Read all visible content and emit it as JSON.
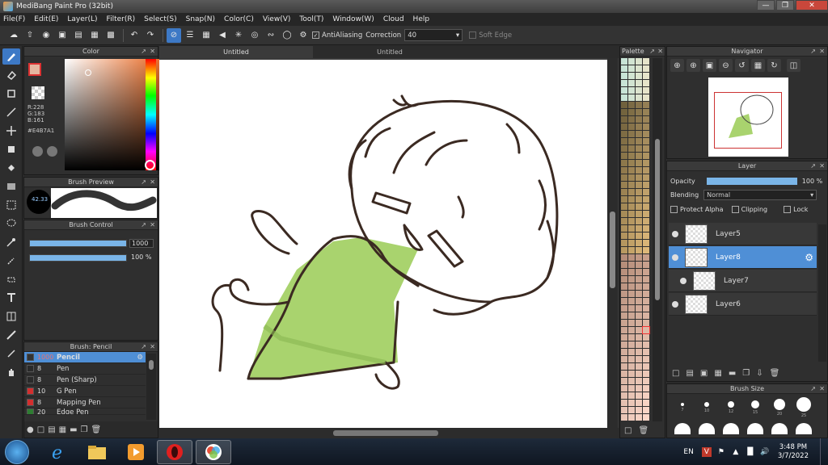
{
  "window": {
    "title": "MediBang Paint Pro (32bit)"
  },
  "menu": [
    "File(F)",
    "Edit(E)",
    "Layer(L)",
    "Filter(R)",
    "Select(S)",
    "Snap(N)",
    "Color(C)",
    "View(V)",
    "Tool(T)",
    "Window(W)",
    "Cloud",
    "Help"
  ],
  "toolbar": {
    "antialiasing_label": "AntiAliasing",
    "correction_label": "Correction",
    "correction_value": "40",
    "soft_edge_label": "Soft Edge"
  },
  "color_panel": {
    "title": "Color",
    "r": "R:228",
    "g": "G:183",
    "b": "B:161",
    "hex": "#E4B7A1",
    "foreground": "#E4B7A1"
  },
  "brush_preview": {
    "title": "Brush Preview",
    "size_label": "42.33"
  },
  "brush_control": {
    "title": "Brush Control",
    "size_value": "1000",
    "opacity_value": "100 %"
  },
  "brush_list": {
    "title": "Brush: Pencil",
    "items": [
      {
        "size": "1000",
        "name": "Pencil",
        "color": "#2a2a2a"
      },
      {
        "size": "8",
        "name": "Pen",
        "color": "#2a2a2a"
      },
      {
        "size": "8",
        "name": "Pen (Sharp)",
        "color": "#2a2a2a"
      },
      {
        "size": "10",
        "name": "G Pen",
        "color": "#d32f2f"
      },
      {
        "size": "8",
        "name": "Mapping Pen",
        "color": "#d32f2f"
      },
      {
        "size": "20",
        "name": "Edge Pen",
        "color": "#2e7d32"
      }
    ]
  },
  "tabs": [
    "Untitled",
    "Untitled"
  ],
  "palette": {
    "title": "Palette"
  },
  "navigator": {
    "title": "Navigator"
  },
  "layer_panel": {
    "title": "Layer",
    "opacity_label": "Opacity",
    "opacity_value": "100 %",
    "blending_label": "Blending",
    "blending_value": "Normal",
    "protect_alpha": "Protect Alpha",
    "clipping": "Clipping",
    "lock": "Lock",
    "layers": [
      {
        "name": "Layer5",
        "selected": false
      },
      {
        "name": "Layer8",
        "selected": true
      },
      {
        "name": "Layer7",
        "selected": false
      },
      {
        "name": "Layer6",
        "selected": false
      }
    ]
  },
  "brush_size": {
    "title": "Brush Size",
    "labels": [
      "7",
      "10",
      "12",
      "15",
      "20",
      "25"
    ]
  },
  "taskbar": {
    "lang": "EN",
    "time": "3:48 PM",
    "date": "3/7/2022"
  }
}
